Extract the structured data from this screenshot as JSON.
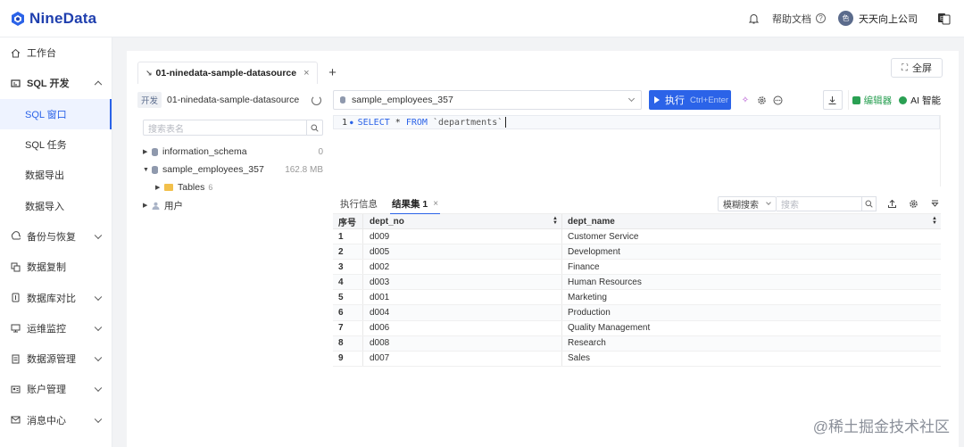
{
  "app": {
    "logo_text": "NineData"
  },
  "header": {
    "help_label": "帮助文档",
    "help_q": "?",
    "org_name": "天天向上公司",
    "avatar_text": "色"
  },
  "sidebar": {
    "items": [
      {
        "label": "工作台",
        "icon": "home-icon"
      },
      {
        "label": "SQL 开发",
        "icon": "sql-dev-icon",
        "expanded": true
      },
      {
        "label": "SQL 窗口",
        "sub": true,
        "active": true
      },
      {
        "label": "SQL 任务",
        "sub": true
      },
      {
        "label": "数据导出",
        "sub": true
      },
      {
        "label": "数据导入",
        "sub": true
      },
      {
        "label": "备份与恢复",
        "icon": "backup-icon"
      },
      {
        "label": "数据复制",
        "icon": "replication-icon"
      },
      {
        "label": "数据库对比",
        "icon": "compare-icon"
      },
      {
        "label": "运维监控",
        "icon": "monitor-icon"
      },
      {
        "label": "数据源管理",
        "icon": "datasource-icon"
      },
      {
        "label": "账户管理",
        "icon": "account-icon"
      },
      {
        "label": "消息中心",
        "icon": "message-icon"
      }
    ]
  },
  "tabs": {
    "active_tab": "01-ninedata-sample-datasource",
    "close": "×",
    "add": "+"
  },
  "fullscreen_label": "全屏",
  "dbpanel": {
    "env_badge": "开发",
    "datasource": "01-ninedata-sample-datasource",
    "search_placeholder": "搜索表名",
    "tree": [
      {
        "label": "information_schema",
        "meta": "0"
      },
      {
        "label": "sample_employees_357",
        "meta": "162.8 MB"
      },
      {
        "label": "Tables",
        "count": "6"
      },
      {
        "label": "用户"
      }
    ]
  },
  "toolbar": {
    "db": "sample_employees_357",
    "run_label": "执行",
    "run_shortcut": "Ctrl+Enter",
    "editor_label": "编辑器",
    "ai_label": "AI 智能"
  },
  "editor": {
    "line_no": "1",
    "sql": {
      "select": "SELECT",
      "star": "*",
      "from": "FROM",
      "table": "`departments`"
    }
  },
  "results": {
    "tab_exec": "执行信息",
    "tab_result": "结果集 1",
    "fuzzy_label": "模糊搜索",
    "search_placeholder": "搜索",
    "columns": [
      "序号",
      "dept_no",
      "dept_name"
    ],
    "rows": [
      [
        "1",
        "d009",
        "Customer Service"
      ],
      [
        "2",
        "d005",
        "Development"
      ],
      [
        "3",
        "d002",
        "Finance"
      ],
      [
        "4",
        "d003",
        "Human Resources"
      ],
      [
        "5",
        "d001",
        "Marketing"
      ],
      [
        "6",
        "d004",
        "Production"
      ],
      [
        "7",
        "d006",
        "Quality Management"
      ],
      [
        "8",
        "d008",
        "Research"
      ],
      [
        "9",
        "d007",
        "Sales"
      ]
    ]
  },
  "watermark": "@稀土掘金技术社区",
  "colors": {
    "accent": "#2b63e8",
    "brand": "#1f3fae",
    "green": "#2aa053"
  }
}
